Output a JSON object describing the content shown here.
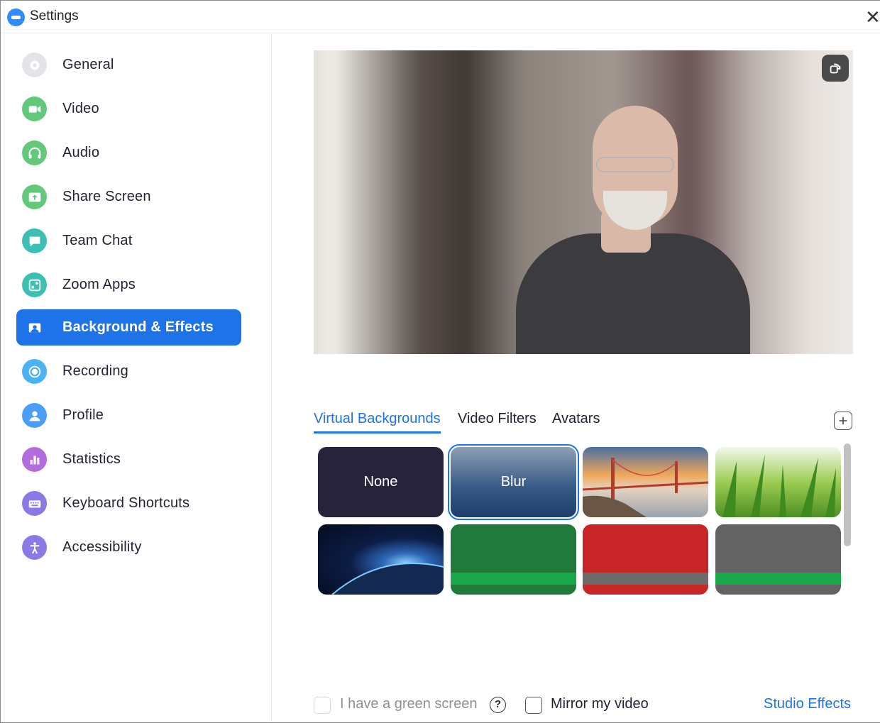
{
  "window": {
    "title": "Settings"
  },
  "sidebar": {
    "items": [
      {
        "label": "General",
        "icon": "gear-icon",
        "color": "#e2e2e6",
        "active": false
      },
      {
        "label": "Video",
        "icon": "video-camera-icon",
        "color": "#62c97a",
        "active": false
      },
      {
        "label": "Audio",
        "icon": "headphones-icon",
        "color": "#62c97a",
        "active": false
      },
      {
        "label": "Share Screen",
        "icon": "share-screen-icon",
        "color": "#62c97a",
        "active": false
      },
      {
        "label": "Team Chat",
        "icon": "chat-bubble-icon",
        "color": "#3cc0b4",
        "active": false
      },
      {
        "label": "Zoom Apps",
        "icon": "apps-icon",
        "color": "#3cc0b4",
        "active": false
      },
      {
        "label": "Background & Effects",
        "icon": "portrait-icon",
        "color": "#1e73e8",
        "active": true
      },
      {
        "label": "Recording",
        "icon": "record-icon",
        "color": "#4bb2f5",
        "active": false
      },
      {
        "label": "Profile",
        "icon": "user-icon",
        "color": "#4b9ef5",
        "active": false
      },
      {
        "label": "Statistics",
        "icon": "bar-chart-icon",
        "color": "#b46be0",
        "active": false
      },
      {
        "label": "Keyboard Shortcuts",
        "icon": "keyboard-icon",
        "color": "#8a7ae6",
        "active": false
      },
      {
        "label": "Accessibility",
        "icon": "accessibility-icon",
        "color": "#8a7ae6",
        "active": false
      }
    ]
  },
  "main": {
    "tabs": [
      {
        "label": "Virtual Backgrounds",
        "active": true
      },
      {
        "label": "Video Filters",
        "active": false
      },
      {
        "label": "Avatars",
        "active": false
      }
    ],
    "backgrounds": [
      {
        "label": "None",
        "kind": "none"
      },
      {
        "label": "Blur",
        "kind": "blur",
        "selected": true
      },
      {
        "label": "",
        "kind": "golden-gate-bridge"
      },
      {
        "label": "",
        "kind": "grass"
      },
      {
        "label": "",
        "kind": "earth-from-space"
      },
      {
        "label": "",
        "kind": "green-branded"
      },
      {
        "label": "",
        "kind": "red-branded"
      },
      {
        "label": "",
        "kind": "gray-branded"
      }
    ],
    "footer": {
      "green_screen_label": "I have a green screen",
      "green_screen_checked": false,
      "help_glyph": "?",
      "mirror_label": "Mirror my video",
      "mirror_checked": false,
      "studio_effects_label": "Studio Effects"
    }
  },
  "colors": {
    "accent": "#1e73e8",
    "text": "#232333",
    "muted": "#8f8f96"
  }
}
